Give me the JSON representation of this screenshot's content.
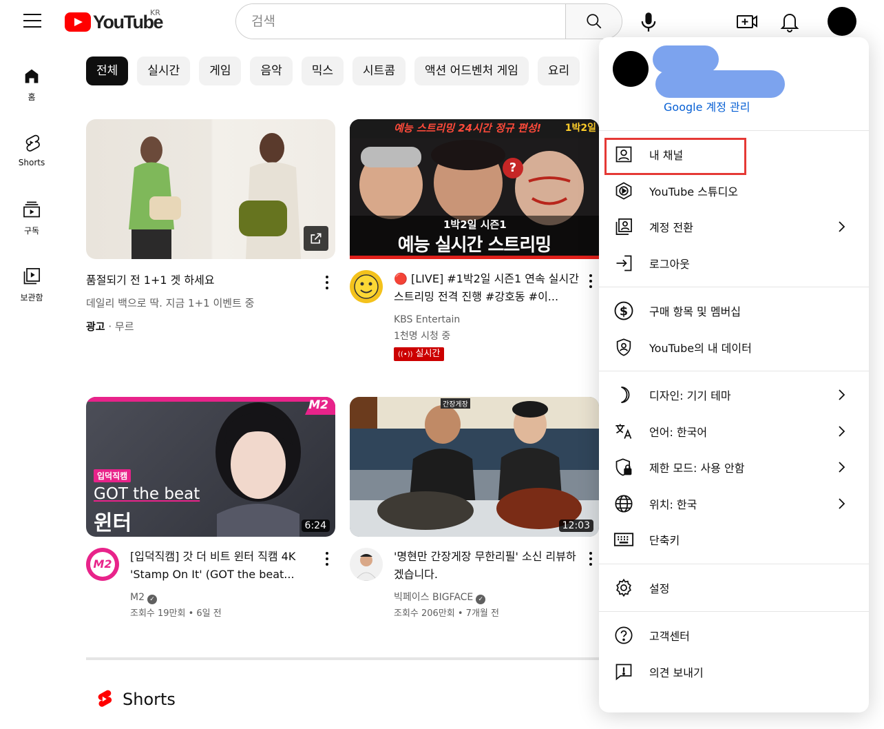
{
  "header": {
    "logo_text": "YouTube",
    "logo_region": "KR",
    "search_placeholder": "검색"
  },
  "sidebar": {
    "items": [
      {
        "label": "홈",
        "icon": "home-icon"
      },
      {
        "label": "Shorts",
        "icon": "shorts-icon"
      },
      {
        "label": "구독",
        "icon": "subscriptions-icon"
      },
      {
        "label": "보관함",
        "icon": "library-icon"
      }
    ]
  },
  "chips": [
    "전체",
    "실시간",
    "게임",
    "음악",
    "믹스",
    "시트콤",
    "액션 어드벤처 게임",
    "요리"
  ],
  "videos": [
    {
      "title": "품절되기 전 1+1 겟 하세요",
      "line1": "데일리 백으로 딱. 지금 1+1 이벤트 중",
      "ad_label": "광고",
      "ad_sep": " · ",
      "advertiser": "무르"
    },
    {
      "title_icon": "🔴",
      "title": "[LIVE] #1박2일 시즌1 연속 실시간 스트리밍 전격 진행 #강호동 #이...",
      "channel": "KBS Entertain",
      "stats": "1천명 시청 중",
      "live_label": "실시간",
      "thumb_top": "예능 스트리밍 24시간 정규 편성!",
      "thumb_tag": "1박2일 시즌1",
      "thumb_main": "예능 실시간 스트리밍",
      "thumb_corner": "1박2일"
    },
    {
      "title": "[입덕직캠] 갓 더 비트 윈터 직캠 4K 'Stamp On It' (GOT the beat...",
      "channel": "M2",
      "stats": "조회수 19만회 • 6일 전",
      "duration": "6:24",
      "thumb_tag": "입덕직캠",
      "thumb_line1": "GOT the beat",
      "thumb_line2": "윈터",
      "thumb_logo": "M2"
    },
    {
      "title": "'명현만 간장게장 무한리필' 소신 리뷰하겠습니다.",
      "channel": "빅페이스 BIGFACE",
      "stats": "조회수 206만회 • 7개월 전",
      "duration": "12:03",
      "thumb_sign": "간장게장"
    }
  ],
  "shorts_title": "Shorts",
  "account_menu": {
    "manage_link": "Google 계정 관리",
    "sections": [
      [
        {
          "label": "내 채널",
          "icon": "account-box-icon",
          "chevron": false,
          "highlighted": true
        },
        {
          "label": "YouTube 스튜디오",
          "icon": "studio-icon",
          "chevron": false
        },
        {
          "label": "계정 전환",
          "icon": "switch-account-icon",
          "chevron": true
        },
        {
          "label": "로그아웃",
          "icon": "sign-out-icon",
          "chevron": false
        }
      ],
      [
        {
          "label": "구매 항목 및 멤버십",
          "icon": "dollar-icon",
          "chevron": false
        },
        {
          "label": "YouTube의 내 데이터",
          "icon": "shield-person-icon",
          "chevron": false
        }
      ],
      [
        {
          "label": "디자인: 기기 테마",
          "icon": "moon-icon",
          "chevron": true
        },
        {
          "label": "언어: 한국어",
          "icon": "translate-icon",
          "chevron": true
        },
        {
          "label": "제한 모드: 사용 안함",
          "icon": "restricted-mode-icon",
          "chevron": true
        },
        {
          "label": "위치: 한국",
          "icon": "globe-icon",
          "chevron": true
        },
        {
          "label": "단축키",
          "icon": "keyboard-icon",
          "chevron": false
        }
      ],
      [
        {
          "label": "설정",
          "icon": "gear-icon",
          "chevron": false
        }
      ],
      [
        {
          "label": "고객센터",
          "icon": "help-icon",
          "chevron": false
        },
        {
          "label": "의견 보내기",
          "icon": "feedback-icon",
          "chevron": false
        }
      ]
    ]
  },
  "colors": {
    "brand_red": "#ff0000",
    "link_blue": "#065fd4",
    "highlight_red": "#e53935",
    "live_red": "#cc0000"
  }
}
